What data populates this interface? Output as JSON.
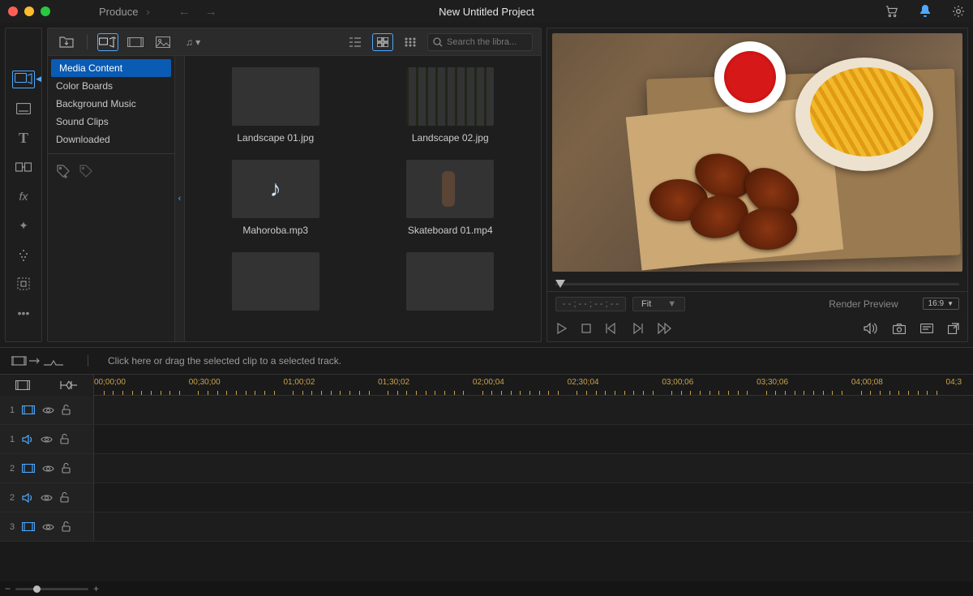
{
  "titlebar": {
    "menu": "Produce",
    "project_title": "New Untitled Project"
  },
  "library": {
    "search_placeholder": "Search the libra...",
    "side_items": [
      "Media Content",
      "Color Boards",
      "Background Music",
      "Sound Clips",
      "Downloaded"
    ],
    "selected_index": 0,
    "items": [
      {
        "label": "Landscape 01.jpg",
        "thumb": "t-landscape1"
      },
      {
        "label": "Landscape 02.jpg",
        "thumb": "t-landscape2"
      },
      {
        "label": "Mahoroba.mp3",
        "thumb": "t-music"
      },
      {
        "label": "Skateboard 01.mp4",
        "thumb": "t-skate1"
      },
      {
        "label": "",
        "thumb": "t-skate2"
      },
      {
        "label": "",
        "thumb": "t-skate3"
      }
    ]
  },
  "preview": {
    "timecode": "- - ; - - ; - - ; - -",
    "fit_label": "Fit",
    "render_label": "Render Preview",
    "aspect_label": "16:9"
  },
  "hintbar": {
    "message": "Click here or drag the selected clip to a selected track."
  },
  "timeline": {
    "ruler": [
      "00;00;00",
      "00;30;00",
      "01;00;02",
      "01;30;02",
      "02;00;04",
      "02;30;04",
      "03;00;06",
      "03;30;06",
      "04;00;08",
      "04;3"
    ],
    "tracks": [
      {
        "num": "1",
        "type": "video"
      },
      {
        "num": "1",
        "type": "audio"
      },
      {
        "num": "2",
        "type": "video"
      },
      {
        "num": "2",
        "type": "audio"
      },
      {
        "num": "3",
        "type": "video"
      }
    ]
  }
}
